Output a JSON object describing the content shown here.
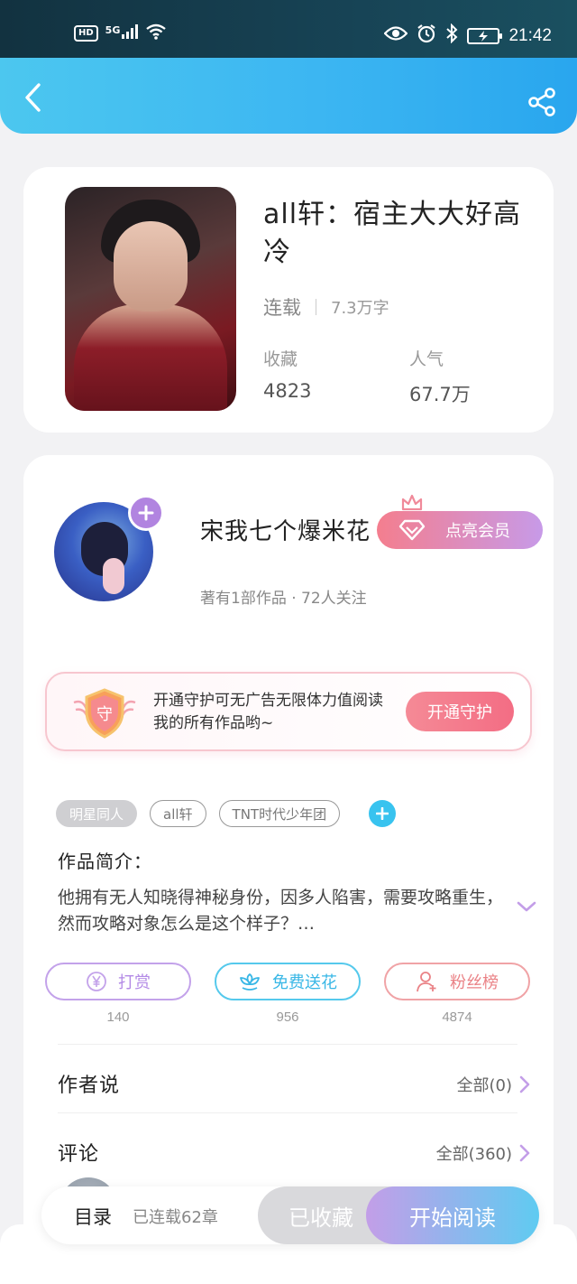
{
  "status_bar": {
    "network": "5G",
    "hd": "HD",
    "time": "21:42"
  },
  "book": {
    "title": "all轩：宿主大大好高冷",
    "status": "连载",
    "word_count": "7.3万字",
    "stats": [
      {
        "label": "收藏",
        "value": "4823"
      },
      {
        "label": "人气",
        "value": "67.7万"
      }
    ]
  },
  "author": {
    "name": "宋我七个爆米花",
    "vip_button": "点亮会员",
    "meta": "著有1部作品 · 72人关注"
  },
  "guard": {
    "text": "开通守护可无广告无限体力值阅读我的所有作品哟~",
    "shield_char": "守",
    "button": "开通守护"
  },
  "tags": [
    "明星同人",
    "all轩",
    "TNT时代少年团"
  ],
  "intro": {
    "label": "作品简介：",
    "text": "他拥有无人知晓得神秘身份，因多人陷害，需要攻略重生，然而攻略对象怎么是这个样子？…"
  },
  "actions": [
    {
      "label": "打赏",
      "icon": "yen-icon",
      "count": "140"
    },
    {
      "label": "免费送花",
      "icon": "flower-icon",
      "count": "956"
    },
    {
      "label": "粉丝榜",
      "icon": "person-icon",
      "count": "4874"
    }
  ],
  "sections": {
    "author_says": {
      "title": "作者说",
      "all": "全部(0)"
    },
    "comments": {
      "title": "评论",
      "all": "全部(360)"
    }
  },
  "bottom": {
    "toc": "目录",
    "toc_meta": "已连载62章",
    "favorited": "已收藏",
    "start_reading": "开始阅读"
  },
  "colors": {
    "header": "#3cb6f2",
    "accent_purple": "#b184e0",
    "accent_pink": "#f36d84",
    "accent_blue": "#38c3ef"
  }
}
